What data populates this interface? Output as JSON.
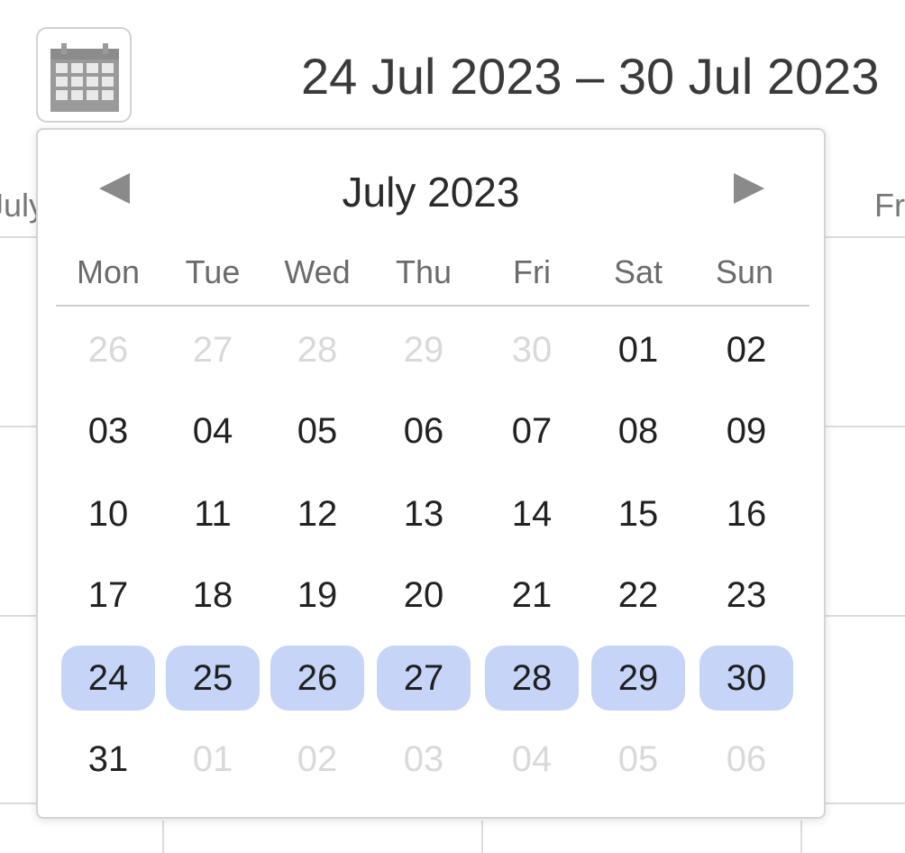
{
  "header": {
    "range_label": "24 Jul 2023 – 30 Jul 2023",
    "calendar_button_icon": "calendar-icon"
  },
  "background": {
    "left_column_header": "July",
    "right_column_header": "Fri"
  },
  "picker": {
    "month_label": "July 2023",
    "prev_icon": "triangle-left-icon",
    "next_icon": "triangle-right-icon",
    "weekdays": [
      "Mon",
      "Tue",
      "Wed",
      "Thu",
      "Fri",
      "Sat",
      "Sun"
    ],
    "weeks": [
      [
        {
          "label": "26",
          "state": "muted"
        },
        {
          "label": "27",
          "state": "muted"
        },
        {
          "label": "28",
          "state": "muted"
        },
        {
          "label": "29",
          "state": "muted"
        },
        {
          "label": "30",
          "state": "muted"
        },
        {
          "label": "01",
          "state": "normal"
        },
        {
          "label": "02",
          "state": "normal"
        }
      ],
      [
        {
          "label": "03",
          "state": "normal"
        },
        {
          "label": "04",
          "state": "normal"
        },
        {
          "label": "05",
          "state": "normal"
        },
        {
          "label": "06",
          "state": "normal"
        },
        {
          "label": "07",
          "state": "normal"
        },
        {
          "label": "08",
          "state": "normal"
        },
        {
          "label": "09",
          "state": "normal"
        }
      ],
      [
        {
          "label": "10",
          "state": "normal"
        },
        {
          "label": "11",
          "state": "normal"
        },
        {
          "label": "12",
          "state": "normal"
        },
        {
          "label": "13",
          "state": "normal"
        },
        {
          "label": "14",
          "state": "normal"
        },
        {
          "label": "15",
          "state": "normal"
        },
        {
          "label": "16",
          "state": "normal"
        }
      ],
      [
        {
          "label": "17",
          "state": "normal"
        },
        {
          "label": "18",
          "state": "normal"
        },
        {
          "label": "19",
          "state": "normal"
        },
        {
          "label": "20",
          "state": "normal"
        },
        {
          "label": "21",
          "state": "normal"
        },
        {
          "label": "22",
          "state": "normal"
        },
        {
          "label": "23",
          "state": "normal"
        }
      ],
      [
        {
          "label": "24",
          "state": "selected"
        },
        {
          "label": "25",
          "state": "selected"
        },
        {
          "label": "26",
          "state": "selected"
        },
        {
          "label": "27",
          "state": "selected"
        },
        {
          "label": "28",
          "state": "selected"
        },
        {
          "label": "29",
          "state": "selected"
        },
        {
          "label": "30",
          "state": "selected"
        }
      ],
      [
        {
          "label": "31",
          "state": "normal"
        },
        {
          "label": "01",
          "state": "muted"
        },
        {
          "label": "02",
          "state": "muted"
        },
        {
          "label": "03",
          "state": "muted"
        },
        {
          "label": "04",
          "state": "muted"
        },
        {
          "label": "05",
          "state": "muted"
        },
        {
          "label": "06",
          "state": "muted"
        }
      ]
    ]
  },
  "colors": {
    "selected_bg": "#c5d4f7",
    "muted_text": "#d9d9d9",
    "normal_text": "#222222",
    "icon_gray": "#9a9a9a"
  }
}
